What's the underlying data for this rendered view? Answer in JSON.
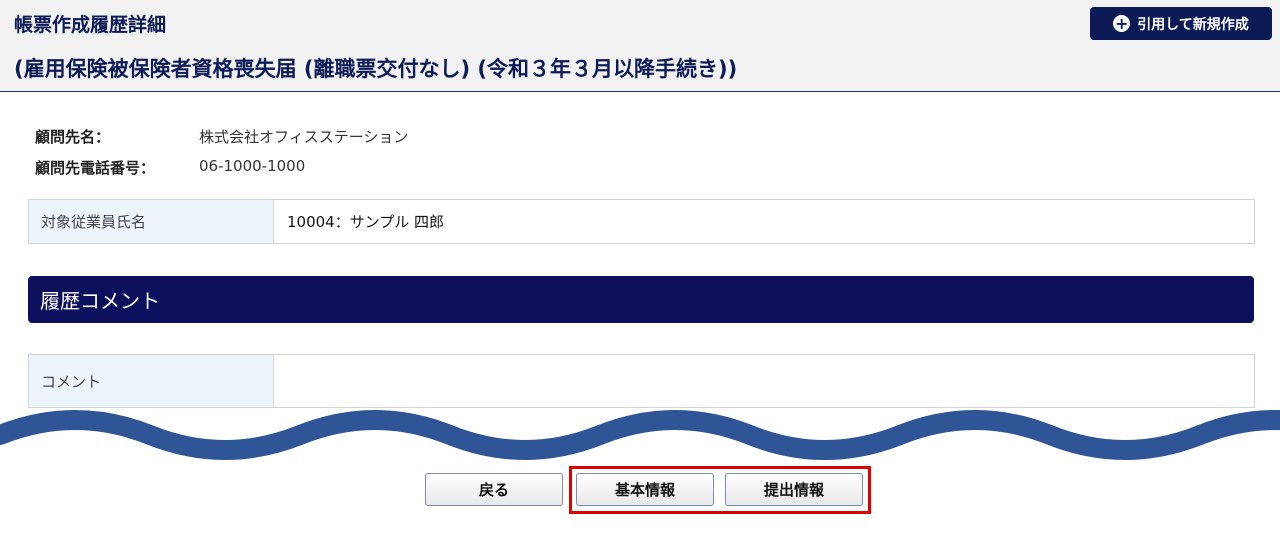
{
  "header": {
    "title": "帳票作成履歴詳細",
    "subtitle": "(雇用保険被保険者資格喪失届 (離職票交付なし) (令和３年３月以降手続き))",
    "cite_button_label": "引用して新規作成",
    "cite_button_icon": "plus-circle-icon"
  },
  "client_info": {
    "name_label": "顧問先名：",
    "name_value": "株式会社オフィスステーション",
    "phone_label": "顧問先電話番号：",
    "phone_value": "06-1000-1000"
  },
  "employee": {
    "label": "対象従業員氏名",
    "value": "10004：サンプル 四郎"
  },
  "history_comment": {
    "section_title": "履歴コメント",
    "comment_label": "コメント",
    "comment_value": ""
  },
  "footer": {
    "back_label": "戻る",
    "basic_info_label": "基本情報",
    "submission_info_label": "提出情報"
  },
  "colors": {
    "navy": "#0b0f5c",
    "wave": "#2f5596",
    "highlight": "#e00000"
  }
}
